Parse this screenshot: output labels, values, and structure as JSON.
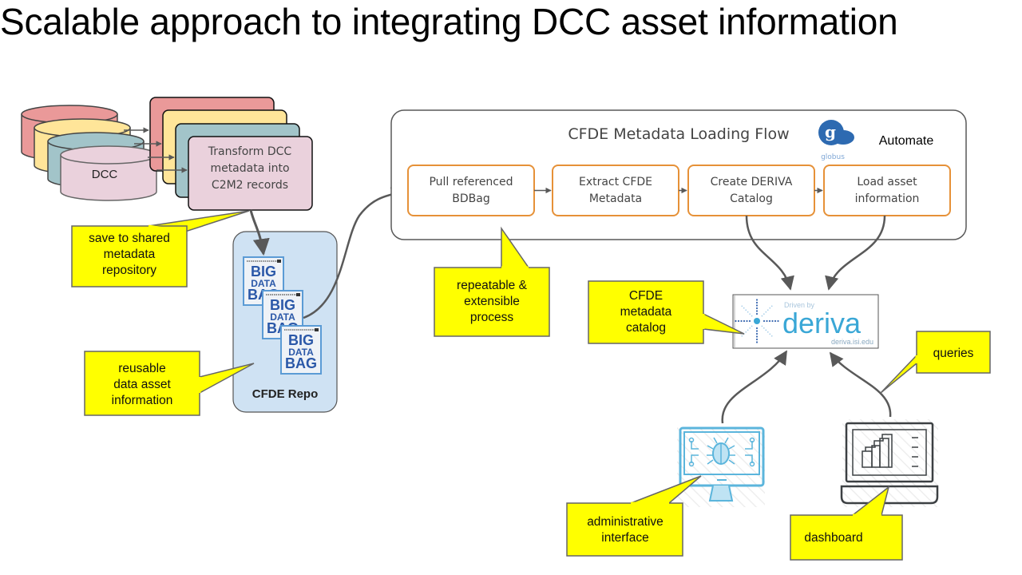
{
  "title": "Scalable approach to integrating DCC asset information",
  "dcc": {
    "label": "DCC",
    "transform": [
      "Transform DCC",
      "metadata into",
      "C2M2 records"
    ],
    "stack_colors": [
      "#ea9999",
      "#ffe599",
      "#a2c4c9",
      "#ead1dc"
    ]
  },
  "repo": {
    "label": "CFDE Repo",
    "bag_lines": [
      "BIG",
      "DATA",
      "BAG"
    ]
  },
  "flow": {
    "title": "CFDE Metadata Loading Flow",
    "automate": "Automate",
    "globus": "globus",
    "steps": [
      [
        "Pull referenced",
        "BDBag"
      ],
      [
        "Extract CFDE",
        "Metadata"
      ],
      [
        "Create DERIVA",
        "Catalog"
      ],
      [
        "Load asset",
        "information"
      ]
    ]
  },
  "deriva": {
    "driven_by": "Driven by",
    "name": "deriva",
    "url": "deriva.isi.edu"
  },
  "callouts": {
    "save": [
      "save to shared",
      "metadata",
      "repository"
    ],
    "reusable": [
      "reusable",
      "data asset",
      "information"
    ],
    "repeatable": [
      "repeatable &",
      "extensible",
      "process"
    ],
    "catalog": [
      "CFDE",
      "metadata",
      "catalog"
    ],
    "queries": [
      "queries"
    ],
    "admin": [
      "administrative",
      "interface"
    ],
    "dashboard": [
      "dashboard"
    ]
  },
  "colors": {
    "callout_fill": "#ffff00",
    "callout_stroke": "#666666",
    "step_border": "#e69138",
    "repo_fill": "#cfe2f3",
    "arrow": "#595959",
    "deriva_blue": "#3aa7d6",
    "bag_blue": "#2b58a8"
  }
}
